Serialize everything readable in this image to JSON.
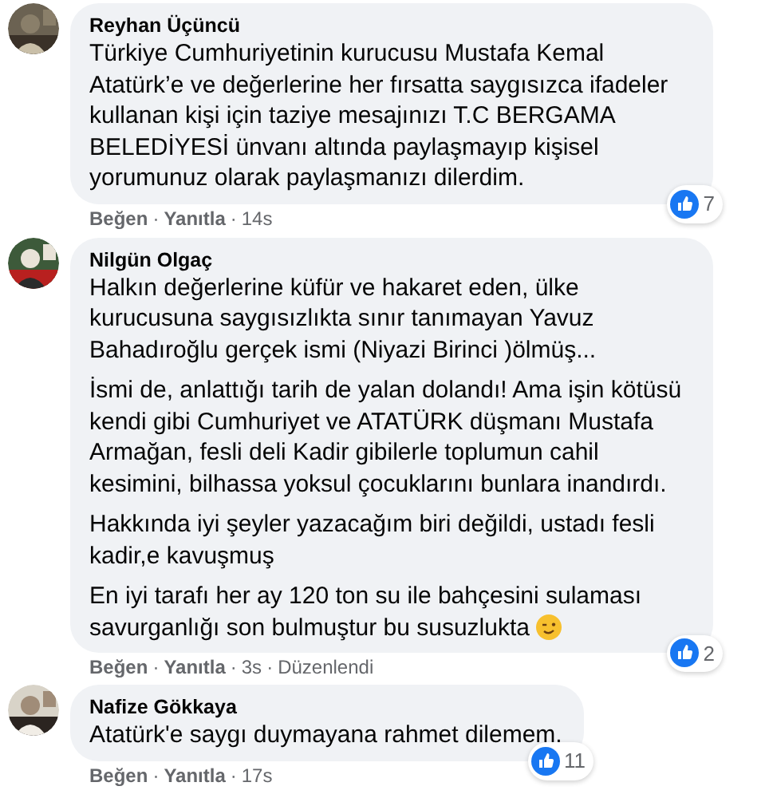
{
  "separator": "·",
  "comments": [
    {
      "author": "Reyhan Üçüncü",
      "paragraphs": [
        "Türkiye Cumhuriyetinin kurucusu Mustafa Kemal Atatürk’e ve değerlerine her fırsatta saygısızca ifadeler kullanan kişi için taziye mesajınızı T.C BERGAMA BELEDİYESİ ünvanı altında paylaşmayıp kişisel yorumunuz olarak paylaşmanızı dilerdim."
      ],
      "like_count": "7",
      "actions": [
        "Beğen",
        "Yanıtla"
      ],
      "time": "14s"
    },
    {
      "author": "Nilgün Olgaç",
      "paragraphs": [
        "Halkın değerlerine küfür ve hakaret eden, ülke kurucusuna saygısızlıkta sınır tanımayan Yavuz Bahadıroğlu gerçek ismi (Niyazi Birinci )ölmüş...",
        "İsmi de, anlattığı tarih de yalan dolandı! Ama işin kötüsü kendi gibi Cumhuriyet ve ATATÜRK düşmanı Mustafa Armağan, fesli deli Kadir gibilerle toplumun cahil kesimini, bilhassa yoksul çocuklarını bunlara inandırdı.",
        "Hakkında iyi şeyler yazacağım biri değildi, ustadı fesli kadir,e kavuşmuş",
        "En iyi tarafı her ay 120 ton su ile bahçesini sulaması savurganlığı son bulmuştur bu susuzlukta"
      ],
      "wink_emoji_at_end": true,
      "like_count": "2",
      "actions": [
        "Beğen",
        "Yanıtla"
      ],
      "time": "3s",
      "edited": "Düzenlendi"
    },
    {
      "author": "Nafize Gökkaya",
      "paragraphs": [
        "Atatürk'e saygı duymayana rahmet dilemem."
      ],
      "like_count": "11",
      "actions": [
        "Beğen",
        "Yanıtla"
      ],
      "time": "17s"
    }
  ]
}
